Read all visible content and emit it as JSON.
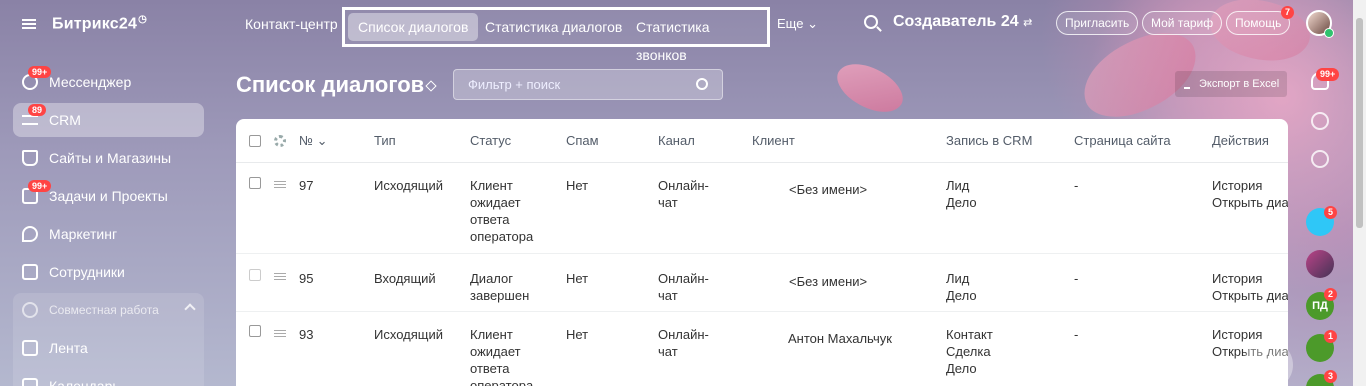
{
  "app": {
    "logo": "Битрикс24",
    "logo_mark": "◷"
  },
  "sidebar": {
    "items": [
      {
        "label": "Мессенджер",
        "badge": "99+"
      },
      {
        "label": "CRM",
        "badge": "89"
      },
      {
        "label": "Сайты и Магазины",
        "badge": ""
      },
      {
        "label": "Задачи и Проекты",
        "badge": "99+"
      },
      {
        "label": "Маркетинг",
        "badge": ""
      },
      {
        "label": "Сотрудники",
        "badge": ""
      }
    ],
    "group": {
      "title": "Совместная работа",
      "items": [
        {
          "label": "Лента"
        },
        {
          "label": "Календарь"
        }
      ]
    }
  },
  "topbar": {
    "contact_center": "Контакт-центр",
    "tabs": [
      {
        "label": "Список диалогов"
      },
      {
        "label": "Статистика диалогов"
      },
      {
        "label": "Статистика звонков"
      }
    ],
    "more": "Еще",
    "portal": "Создаватель 24",
    "invite": "Пригласить",
    "tariff": "Мой тариф",
    "help": "Помощь",
    "help_badge": "7"
  },
  "page": {
    "title": "Список диалогов",
    "filter_placeholder": "Фильтр + поиск",
    "export": "Экспорт в Excel"
  },
  "table": {
    "headers": [
      "№",
      "Тип",
      "Статус",
      "Спам",
      "Канал",
      "Клиент",
      "Запись в CRM",
      "Страница сайта",
      "Действия"
    ],
    "rows": [
      {
        "id": "97",
        "type": "Исходящий",
        "status": [
          "Клиент",
          "ожидает",
          "ответа",
          "оператора"
        ],
        "spam": "Нет",
        "channel": [
          "Онлайн-",
          "чат"
        ],
        "client": "<Без имени>",
        "crm": [
          "Лид",
          "Дело"
        ],
        "page": "-",
        "actions": [
          "История",
          "Открыть диалог"
        ]
      },
      {
        "id": "95",
        "type": "Входящий",
        "status": [
          "Диалог",
          "завершен"
        ],
        "spam": "Нет",
        "channel": [
          "Онлайн-",
          "чат"
        ],
        "client": "<Без имени>",
        "crm": [
          "Лид",
          "Дело"
        ],
        "page": "-",
        "actions": [
          "История",
          "Открыть диалог"
        ]
      },
      {
        "id": "93",
        "type": "Исходящий",
        "status": [
          "Клиент",
          "ожидает",
          "ответа",
          "оператора"
        ],
        "spam": "Нет",
        "channel": [
          "Онлайн-",
          "чат"
        ],
        "client": "Антон Махальчук",
        "crm": [
          "Контакт",
          "Сделка",
          "Дело"
        ],
        "page": "-",
        "actions": [
          "История",
          "Открыть диалог"
        ]
      }
    ]
  },
  "right_bar": {
    "badges": [
      "99+",
      "5",
      "2",
      "1",
      "3"
    ],
    "initials": "ПД"
  }
}
